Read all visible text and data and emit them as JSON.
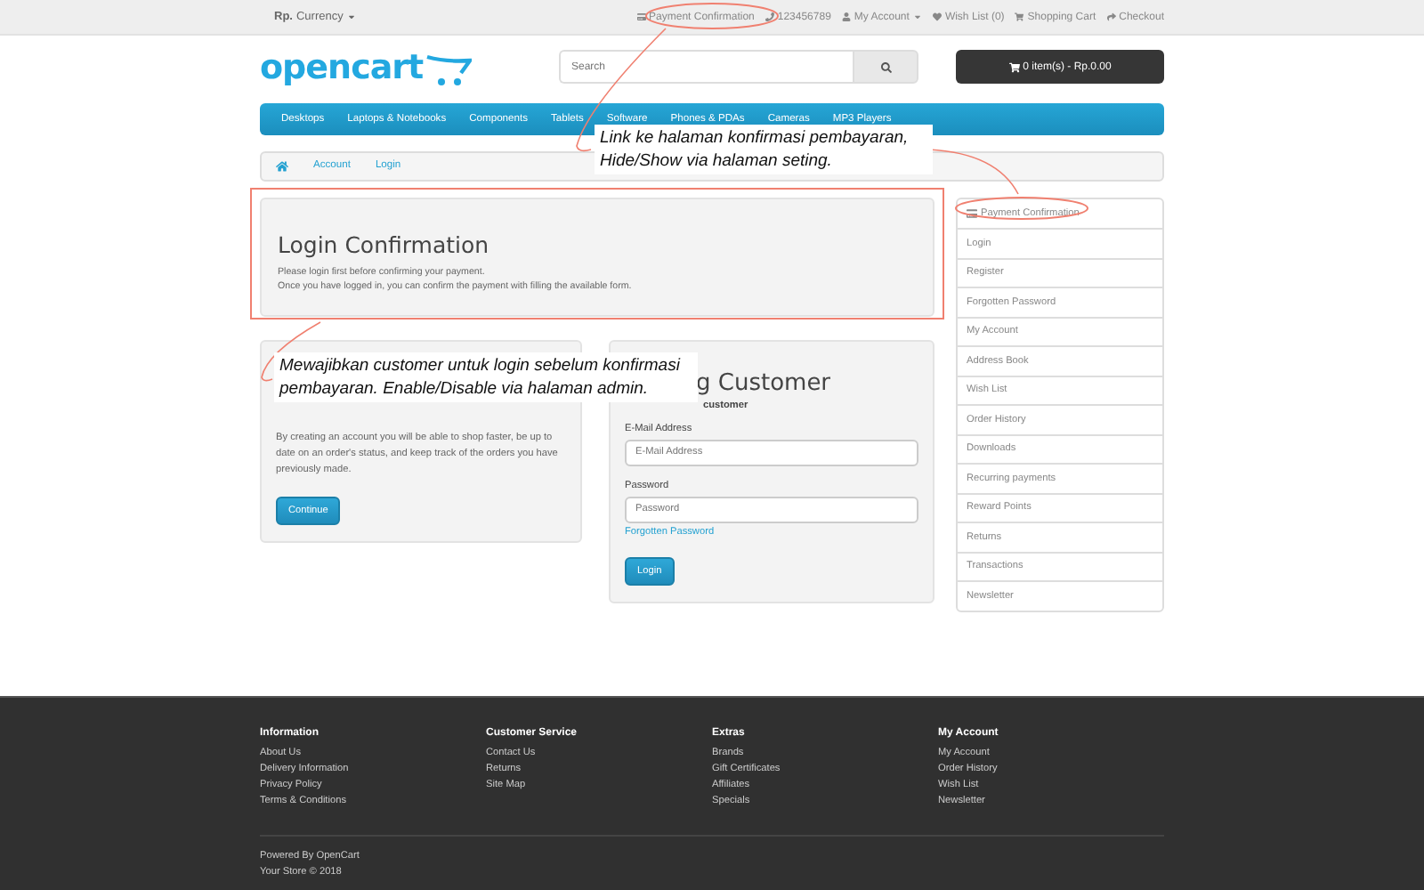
{
  "top_bar": {
    "currency_symbol": "Rp.",
    "currency_label": "Currency",
    "links": [
      {
        "label": "Payment Confirmation",
        "dropdown": false
      },
      {
        "label": "123456789",
        "dropdown": false
      },
      {
        "label": "My Account",
        "dropdown": true
      },
      {
        "label": "Wish List (0)",
        "dropdown": false
      },
      {
        "label": "Shopping Cart",
        "dropdown": false
      },
      {
        "label": "Checkout",
        "dropdown": false
      }
    ]
  },
  "header": {
    "logo": "opencart",
    "search_placeholder": "Search",
    "cart": "0 item(s) - Rp.0.00"
  },
  "nav": [
    "Desktops",
    "Laptops & Notebooks",
    "Components",
    "Tablets",
    "Software",
    "Phones & PDAs",
    "Cameras",
    "MP3 Players"
  ],
  "breadcrumb": [
    "Account",
    "Login"
  ],
  "confirmation": {
    "title": "Login Confirmation",
    "lines": [
      "Please login first before confirming your payment.",
      "Once you have logged in, you can confirm the payment with filling the available form."
    ]
  },
  "new_customer": {
    "text": "By creating an account you will be able to shop faster, be up to date on an order's status, and keep track of the orders you have previously made.",
    "button": "Continue"
  },
  "returning_customer": {
    "heading": "g Customer",
    "subtitle": "customer",
    "email_label": "E-Mail Address",
    "email_placeholder": "E-Mail Address",
    "password_label": "Password",
    "password_placeholder": "Password",
    "forgotten": "Forgotten Password",
    "button": "Login"
  },
  "sidebar": [
    {
      "label": "Payment Confirmation",
      "kind": "payment"
    },
    {
      "label": "Login",
      "kind": "link"
    },
    {
      "label": "Register",
      "kind": "link"
    },
    {
      "label": "Forgotten Password",
      "kind": "link"
    },
    {
      "label": "My Account",
      "kind": "link"
    },
    {
      "label": "Address Book",
      "kind": "link"
    },
    {
      "label": "Wish List",
      "kind": "link"
    },
    {
      "label": "Order History",
      "kind": "link"
    },
    {
      "label": "Downloads",
      "kind": "link"
    },
    {
      "label": "Recurring payments",
      "kind": "link"
    },
    {
      "label": "Reward Points",
      "kind": "link"
    },
    {
      "label": "Returns",
      "kind": "link"
    },
    {
      "label": "Transactions",
      "kind": "link"
    },
    {
      "label": "Newsletter",
      "kind": "link"
    }
  ],
  "footer": {
    "columns": [
      {
        "title": "Information",
        "links": [
          "About Us",
          "Delivery Information",
          "Privacy Policy",
          "Terms & Conditions"
        ]
      },
      {
        "title": "Customer Service",
        "links": [
          "Contact Us",
          "Returns",
          "Site Map"
        ]
      },
      {
        "title": "Extras",
        "links": [
          "Brands",
          "Gift Certificates",
          "Affiliates",
          "Specials"
        ]
      },
      {
        "title": "My Account",
        "links": [
          "My Account",
          "Order History",
          "Wish List",
          "Newsletter"
        ]
      }
    ],
    "powered": "Powered By OpenCart",
    "copyright": "Your Store © 2018"
  },
  "annotations": [
    "Link ke halaman konfirmasi pembayaran, Hide/Show via halaman seting.",
    "Mewajibkan customer untuk login sebelum konfirmasi pembayaran. Enable/Disable via halaman admin."
  ]
}
